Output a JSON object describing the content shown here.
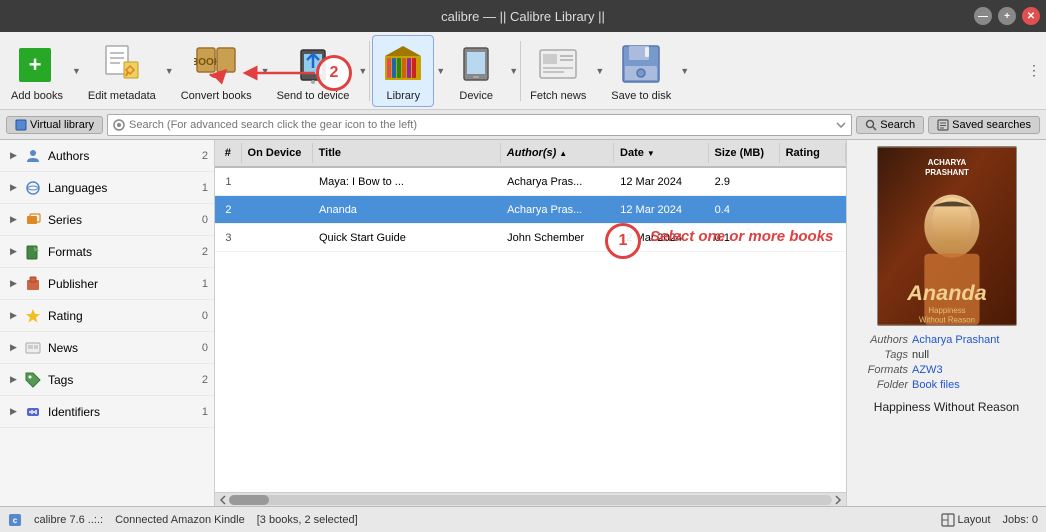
{
  "titlebar": {
    "title": "calibre — || Calibre Library ||"
  },
  "winControls": {
    "min": "—",
    "max": "+",
    "close": "✕"
  },
  "toolbar": {
    "addBooks": "Add books",
    "editMetadata": "Edit metadata",
    "convertBooks": "Convert books",
    "sendToDevice": "Send to device",
    "library": "Library",
    "device": "Device",
    "fetchNews": "Fetch news",
    "saveToDisk": "Save to disk"
  },
  "searchBar": {
    "virtualLibrary": "Virtual library",
    "placeholder": "Search (For advanced search click the gear icon to the left)",
    "searchBtn": "Search",
    "savedSearches": "Saved searches"
  },
  "sidebar": {
    "items": [
      {
        "label": "Authors",
        "count": "2",
        "icon": "authors"
      },
      {
        "label": "Languages",
        "count": "1",
        "icon": "languages"
      },
      {
        "label": "Series",
        "count": "0",
        "icon": "series"
      },
      {
        "label": "Formats",
        "count": "2",
        "icon": "formats"
      },
      {
        "label": "Publisher",
        "count": "1",
        "icon": "publisher"
      },
      {
        "label": "Rating",
        "count": "0",
        "icon": "rating"
      },
      {
        "label": "News",
        "count": "0",
        "icon": "news"
      },
      {
        "label": "Tags",
        "count": "2",
        "icon": "tags"
      },
      {
        "label": "Identifiers",
        "count": "1",
        "icon": "identifiers"
      }
    ]
  },
  "tableHeaders": {
    "onDevice": "On Device",
    "title": "Title",
    "authors": "Author(s)",
    "date": "Date",
    "size": "Size (MB)",
    "rating": "Rating"
  },
  "books": [
    {
      "num": "1",
      "onDevice": "",
      "title": "Maya: I Bow to ...",
      "authors": "Acharya Pras...",
      "date": "12 Mar 2024",
      "size": "2.9",
      "rating": "",
      "selected": false
    },
    {
      "num": "2",
      "onDevice": "",
      "title": "Ananda",
      "authors": "Acharya Pras...",
      "date": "12 Mar 2024",
      "size": "0.4",
      "rating": "",
      "selected": true
    },
    {
      "num": "3",
      "onDevice": "",
      "title": "Quick Start Guide",
      "authors": "John Schember",
      "date": "12 Mar 2024",
      "size": "0.1",
      "rating": "",
      "selected": false
    }
  ],
  "preview": {
    "coverAlt": "Ananda book cover",
    "authorLabel": "Authors",
    "authorValue": "Acharya Prashant",
    "tagsLabel": "Tags",
    "tagsValue": "null",
    "formatsLabel": "Formats",
    "formatsValue": "AZW3",
    "folderLabel": "Folder",
    "folderValue": "Book files",
    "titleDisplay": "Happiness Without Reason",
    "coverNameText": "ACHARYA\nPRASHANT",
    "coverSubTitle": "Happiness\nWithout Reason"
  },
  "annotations": {
    "circle1Label": "1",
    "circle2Label": "2",
    "selectText": "Select one or more books"
  },
  "statusBar": {
    "calibreVersion": "calibre 7.6 ..:.:",
    "connectedDevice": "Connected Amazon Kindle",
    "bookCount": "[3 books, 2 selected]",
    "layout": "Layout",
    "jobs": "Jobs: 0"
  }
}
